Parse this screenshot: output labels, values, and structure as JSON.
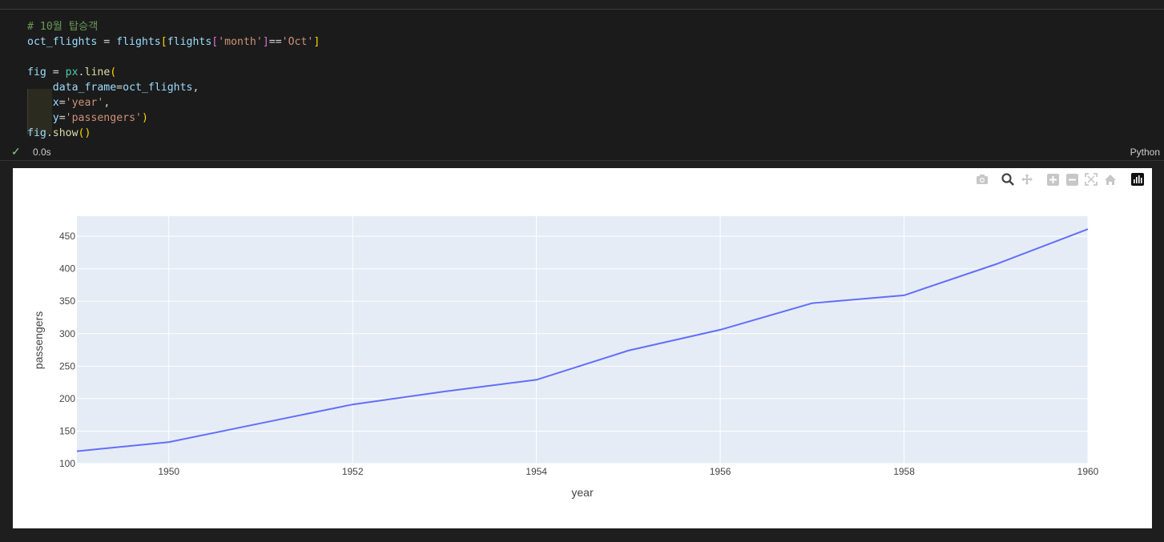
{
  "code_lines": [
    [
      {
        "c": "c-comment",
        "t": "# 10월 탑승객"
      }
    ],
    [
      {
        "c": "c-var",
        "t": "oct_flights"
      },
      {
        "c": "",
        "t": " = "
      },
      {
        "c": "c-var",
        "t": "flights"
      },
      {
        "c": "c-br1",
        "t": "["
      },
      {
        "c": "c-var",
        "t": "flights"
      },
      {
        "c": "c-br2",
        "t": "["
      },
      {
        "c": "c-str",
        "t": "'month'"
      },
      {
        "c": "c-br2",
        "t": "]"
      },
      {
        "c": "",
        "t": "=="
      },
      {
        "c": "c-str",
        "t": "'Oct'"
      },
      {
        "c": "c-br1",
        "t": "]"
      }
    ],
    [],
    [
      {
        "c": "c-var",
        "t": "fig"
      },
      {
        "c": "",
        "t": " = "
      },
      {
        "c": "c-mod",
        "t": "px"
      },
      {
        "c": "",
        "t": "."
      },
      {
        "c": "c-fn",
        "t": "line"
      },
      {
        "c": "c-br1",
        "t": "("
      }
    ],
    [
      {
        "c": "",
        "t": "    "
      },
      {
        "c": "c-var",
        "t": "data_frame"
      },
      {
        "c": "",
        "t": "="
      },
      {
        "c": "c-var",
        "t": "oct_flights"
      },
      {
        "c": "",
        "t": ","
      }
    ],
    [
      {
        "c": "",
        "t": "    "
      },
      {
        "c": "c-var",
        "t": "x"
      },
      {
        "c": "",
        "t": "="
      },
      {
        "c": "c-str",
        "t": "'year'"
      },
      {
        "c": "",
        "t": ","
      }
    ],
    [
      {
        "c": "",
        "t": "    "
      },
      {
        "c": "c-var",
        "t": "y"
      },
      {
        "c": "",
        "t": "="
      },
      {
        "c": "c-str",
        "t": "'passengers'"
      },
      {
        "c": "c-br1",
        "t": ")"
      }
    ],
    [
      {
        "c": "c-var",
        "t": "fig"
      },
      {
        "c": "",
        "t": "."
      },
      {
        "c": "c-fn",
        "t": "show"
      },
      {
        "c": "c-br1",
        "t": "()"
      }
    ]
  ],
  "status": {
    "check_icon": "check-icon",
    "exec_time": "0.0s",
    "language": "Python"
  },
  "modebar": [
    "camera-icon",
    "zoom-icon",
    "pan-icon",
    "zoom-in-icon",
    "zoom-out-icon",
    "autoscale-icon",
    "reset-axes-icon",
    "plotly-logo-icon"
  ],
  "chart_data": {
    "type": "line",
    "x": [
      1949,
      1950,
      1951,
      1952,
      1953,
      1954,
      1955,
      1956,
      1957,
      1958,
      1959,
      1960
    ],
    "series": [
      {
        "values": [
          119,
          133,
          162,
          191,
          211,
          229,
          274,
          306,
          347,
          359,
          407,
          461
        ],
        "color": "#636efa"
      }
    ],
    "xlabel": "year",
    "ylabel": "passengers",
    "xticks": [
      "1950",
      "1952",
      "1954",
      "1956",
      "1958",
      "1960"
    ],
    "yticks": [
      "100",
      "150",
      "200",
      "250",
      "300",
      "350",
      "400",
      "450"
    ],
    "xlim": [
      1949,
      1960
    ],
    "ylim": [
      100,
      481
    ],
    "grid": true,
    "plot_bg": "#e5ecf6"
  }
}
